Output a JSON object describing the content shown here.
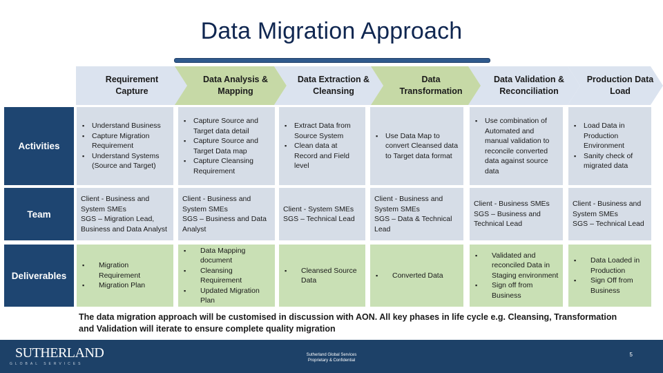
{
  "title": "Data Migration Approach",
  "phases": [
    {
      "label": "Requirement Capture",
      "color": "blue"
    },
    {
      "label": "Data Analysis & Mapping",
      "color": "green"
    },
    {
      "label": "Data Extraction & Cleansing",
      "color": "blue"
    },
    {
      "label": "Data Transformation",
      "color": "green"
    },
    {
      "label": "Data Validation & Reconciliation",
      "color": "blue"
    },
    {
      "label": "Production Data Load",
      "color": "blue"
    }
  ],
  "rows": {
    "activities": {
      "label": "Activities",
      "cells": [
        [
          "Understand Business",
          "Capture Migration Requirement",
          "Understand Systems (Source and Target)"
        ],
        [
          "Capture Source and Target data detail",
          "Capture Source and Target Data map",
          "Capture Cleansing Requirement"
        ],
        [
          "Extract Data from Source System",
          "Clean data at Record and Field level"
        ],
        [
          "Use Data Map to convert Cleansed data to Target data format"
        ],
        [
          "Use combination of Automated and manual validation to reconcile converted data against source data"
        ],
        [
          "Load Data in Production Environment",
          "Sanity check of migrated data"
        ]
      ]
    },
    "team": {
      "label": "Team",
      "cells": [
        "Client - Business and System SMEs\nSGS –  Migration Lead, Business and Data Analyst",
        "Client - Business and System SMEs\nSGS – Business and Data Analyst",
        "Client - System SMEs\nSGS – Technical Lead",
        "Client - Business and System SMEs\nSGS – Data & Technical Lead",
        "Client - Business SMEs\nSGS – Business and Technical Lead",
        "Client - Business and System SMEs\nSGS – Technical Lead"
      ]
    },
    "deliverables": {
      "label": "Deliverables",
      "cells": [
        [
          "Migration Requirement",
          "Migration Plan"
        ],
        [
          "Data Mapping document",
          "Cleansing Requirement",
          "Updated Migration Plan"
        ],
        [
          "Cleansed Source Data"
        ],
        [
          "Converted Data"
        ],
        [
          "Validated and reconciled Data in Staging environment",
          "Sign off from Business"
        ],
        [
          "Data Loaded in Production",
          "Sign Off from Business"
        ]
      ]
    }
  },
  "note": "The data migration approach will be customised in discussion with AON. All key phases in life cycle e.g. Cleansing, Transformation and Validation will iterate to ensure complete quality migration",
  "footer": {
    "logo": "SUTHERLAND",
    "logo_sub": "GLOBAL SERVICES",
    "center_line1": "Sutherland Global Services",
    "center_line2": "Proprietary & Confidential",
    "page": "5"
  },
  "colors": {
    "title": "#0f2650",
    "row_label_bg": "#1e4571",
    "chevron_blue": "#dbe3ef",
    "chevron_green": "#c6d9a6",
    "cell_gray": "#d6dde7",
    "cell_green": "#c9e0b5",
    "footer_bg": "#1d4168"
  }
}
